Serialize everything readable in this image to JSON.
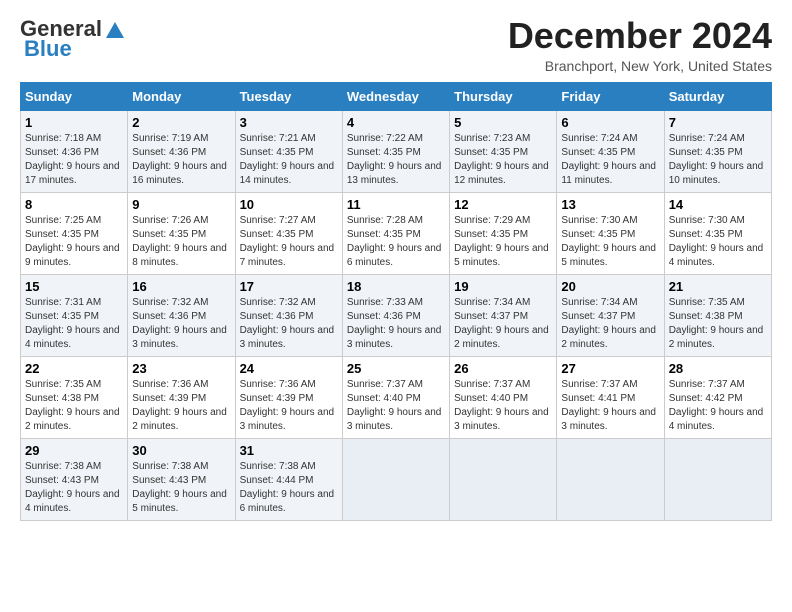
{
  "header": {
    "logo_general": "General",
    "logo_blue": "Blue",
    "month_title": "December 2024",
    "location": "Branchport, New York, United States"
  },
  "days_of_week": [
    "Sunday",
    "Monday",
    "Tuesday",
    "Wednesday",
    "Thursday",
    "Friday",
    "Saturday"
  ],
  "weeks": [
    [
      {
        "day": "1",
        "sunrise": "Sunrise: 7:18 AM",
        "sunset": "Sunset: 4:36 PM",
        "daylight": "Daylight: 9 hours and 17 minutes."
      },
      {
        "day": "2",
        "sunrise": "Sunrise: 7:19 AM",
        "sunset": "Sunset: 4:36 PM",
        "daylight": "Daylight: 9 hours and 16 minutes."
      },
      {
        "day": "3",
        "sunrise": "Sunrise: 7:21 AM",
        "sunset": "Sunset: 4:35 PM",
        "daylight": "Daylight: 9 hours and 14 minutes."
      },
      {
        "day": "4",
        "sunrise": "Sunrise: 7:22 AM",
        "sunset": "Sunset: 4:35 PM",
        "daylight": "Daylight: 9 hours and 13 minutes."
      },
      {
        "day": "5",
        "sunrise": "Sunrise: 7:23 AM",
        "sunset": "Sunset: 4:35 PM",
        "daylight": "Daylight: 9 hours and 12 minutes."
      },
      {
        "day": "6",
        "sunrise": "Sunrise: 7:24 AM",
        "sunset": "Sunset: 4:35 PM",
        "daylight": "Daylight: 9 hours and 11 minutes."
      },
      {
        "day": "7",
        "sunrise": "Sunrise: 7:24 AM",
        "sunset": "Sunset: 4:35 PM",
        "daylight": "Daylight: 9 hours and 10 minutes."
      }
    ],
    [
      {
        "day": "8",
        "sunrise": "Sunrise: 7:25 AM",
        "sunset": "Sunset: 4:35 PM",
        "daylight": "Daylight: 9 hours and 9 minutes."
      },
      {
        "day": "9",
        "sunrise": "Sunrise: 7:26 AM",
        "sunset": "Sunset: 4:35 PM",
        "daylight": "Daylight: 9 hours and 8 minutes."
      },
      {
        "day": "10",
        "sunrise": "Sunrise: 7:27 AM",
        "sunset": "Sunset: 4:35 PM",
        "daylight": "Daylight: 9 hours and 7 minutes."
      },
      {
        "day": "11",
        "sunrise": "Sunrise: 7:28 AM",
        "sunset": "Sunset: 4:35 PM",
        "daylight": "Daylight: 9 hours and 6 minutes."
      },
      {
        "day": "12",
        "sunrise": "Sunrise: 7:29 AM",
        "sunset": "Sunset: 4:35 PM",
        "daylight": "Daylight: 9 hours and 5 minutes."
      },
      {
        "day": "13",
        "sunrise": "Sunrise: 7:30 AM",
        "sunset": "Sunset: 4:35 PM",
        "daylight": "Daylight: 9 hours and 5 minutes."
      },
      {
        "day": "14",
        "sunrise": "Sunrise: 7:30 AM",
        "sunset": "Sunset: 4:35 PM",
        "daylight": "Daylight: 9 hours and 4 minutes."
      }
    ],
    [
      {
        "day": "15",
        "sunrise": "Sunrise: 7:31 AM",
        "sunset": "Sunset: 4:35 PM",
        "daylight": "Daylight: 9 hours and 4 minutes."
      },
      {
        "day": "16",
        "sunrise": "Sunrise: 7:32 AM",
        "sunset": "Sunset: 4:36 PM",
        "daylight": "Daylight: 9 hours and 3 minutes."
      },
      {
        "day": "17",
        "sunrise": "Sunrise: 7:32 AM",
        "sunset": "Sunset: 4:36 PM",
        "daylight": "Daylight: 9 hours and 3 minutes."
      },
      {
        "day": "18",
        "sunrise": "Sunrise: 7:33 AM",
        "sunset": "Sunset: 4:36 PM",
        "daylight": "Daylight: 9 hours and 3 minutes."
      },
      {
        "day": "19",
        "sunrise": "Sunrise: 7:34 AM",
        "sunset": "Sunset: 4:37 PM",
        "daylight": "Daylight: 9 hours and 2 minutes."
      },
      {
        "day": "20",
        "sunrise": "Sunrise: 7:34 AM",
        "sunset": "Sunset: 4:37 PM",
        "daylight": "Daylight: 9 hours and 2 minutes."
      },
      {
        "day": "21",
        "sunrise": "Sunrise: 7:35 AM",
        "sunset": "Sunset: 4:38 PM",
        "daylight": "Daylight: 9 hours and 2 minutes."
      }
    ],
    [
      {
        "day": "22",
        "sunrise": "Sunrise: 7:35 AM",
        "sunset": "Sunset: 4:38 PM",
        "daylight": "Daylight: 9 hours and 2 minutes."
      },
      {
        "day": "23",
        "sunrise": "Sunrise: 7:36 AM",
        "sunset": "Sunset: 4:39 PM",
        "daylight": "Daylight: 9 hours and 2 minutes."
      },
      {
        "day": "24",
        "sunrise": "Sunrise: 7:36 AM",
        "sunset": "Sunset: 4:39 PM",
        "daylight": "Daylight: 9 hours and 3 minutes."
      },
      {
        "day": "25",
        "sunrise": "Sunrise: 7:37 AM",
        "sunset": "Sunset: 4:40 PM",
        "daylight": "Daylight: 9 hours and 3 minutes."
      },
      {
        "day": "26",
        "sunrise": "Sunrise: 7:37 AM",
        "sunset": "Sunset: 4:40 PM",
        "daylight": "Daylight: 9 hours and 3 minutes."
      },
      {
        "day": "27",
        "sunrise": "Sunrise: 7:37 AM",
        "sunset": "Sunset: 4:41 PM",
        "daylight": "Daylight: 9 hours and 3 minutes."
      },
      {
        "day": "28",
        "sunrise": "Sunrise: 7:37 AM",
        "sunset": "Sunset: 4:42 PM",
        "daylight": "Daylight: 9 hours and 4 minutes."
      }
    ],
    [
      {
        "day": "29",
        "sunrise": "Sunrise: 7:38 AM",
        "sunset": "Sunset: 4:43 PM",
        "daylight": "Daylight: 9 hours and 4 minutes."
      },
      {
        "day": "30",
        "sunrise": "Sunrise: 7:38 AM",
        "sunset": "Sunset: 4:43 PM",
        "daylight": "Daylight: 9 hours and 5 minutes."
      },
      {
        "day": "31",
        "sunrise": "Sunrise: 7:38 AM",
        "sunset": "Sunset: 4:44 PM",
        "daylight": "Daylight: 9 hours and 6 minutes."
      },
      {
        "day": "",
        "sunrise": "",
        "sunset": "",
        "daylight": ""
      },
      {
        "day": "",
        "sunrise": "",
        "sunset": "",
        "daylight": ""
      },
      {
        "day": "",
        "sunrise": "",
        "sunset": "",
        "daylight": ""
      },
      {
        "day": "",
        "sunrise": "",
        "sunset": "",
        "daylight": ""
      }
    ]
  ]
}
